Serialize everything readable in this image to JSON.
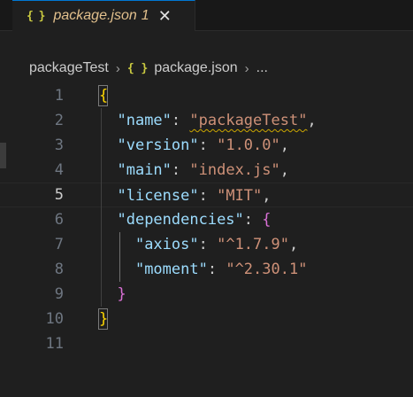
{
  "tab": {
    "icon": "{ }",
    "icon_name": "json-icon",
    "filename": "package.json",
    "problem_count": "1",
    "close_glyph": "✕",
    "accent_color": "#0078d4",
    "modified_color": "#e2c08d"
  },
  "breadcrumb": {
    "folder": "packageTest",
    "separator": "›",
    "icon": "{ }",
    "file": "package.json",
    "more": "..."
  },
  "editor": {
    "active_line": 5,
    "lines": [
      {
        "number": "1",
        "indent": "",
        "tokens": [
          {
            "t": "{",
            "c": "b1"
          }
        ]
      },
      {
        "number": "2",
        "indent": "  ",
        "tokens": [
          {
            "t": "\"name\"",
            "c": "key"
          },
          {
            "t": ": ",
            "c": "punct"
          },
          {
            "t": "\"packageTest\"",
            "c": "str",
            "squiggle": true
          },
          {
            "t": ",",
            "c": "punct"
          }
        ]
      },
      {
        "number": "3",
        "indent": "  ",
        "tokens": [
          {
            "t": "\"version\"",
            "c": "key"
          },
          {
            "t": ": ",
            "c": "punct"
          },
          {
            "t": "\"1.0.0\"",
            "c": "str"
          },
          {
            "t": ",",
            "c": "punct"
          }
        ]
      },
      {
        "number": "4",
        "indent": "  ",
        "tokens": [
          {
            "t": "\"main\"",
            "c": "key"
          },
          {
            "t": ": ",
            "c": "punct"
          },
          {
            "t": "\"index.js\"",
            "c": "str"
          },
          {
            "t": ",",
            "c": "punct"
          }
        ]
      },
      {
        "number": "5",
        "indent": "  ",
        "tokens": [
          {
            "t": "\"license\"",
            "c": "key"
          },
          {
            "t": ": ",
            "c": "punct"
          },
          {
            "t": "\"MIT\"",
            "c": "str"
          },
          {
            "t": ",",
            "c": "punct"
          }
        ]
      },
      {
        "number": "6",
        "indent": "  ",
        "tokens": [
          {
            "t": "\"dependencies\"",
            "c": "key"
          },
          {
            "t": ": ",
            "c": "punct"
          },
          {
            "t": "{",
            "c": "b2"
          }
        ]
      },
      {
        "number": "7",
        "indent": "    ",
        "tokens": [
          {
            "t": "\"axios\"",
            "c": "key"
          },
          {
            "t": ": ",
            "c": "punct"
          },
          {
            "t": "\"^1.7.9\"",
            "c": "str"
          },
          {
            "t": ",",
            "c": "punct"
          }
        ]
      },
      {
        "number": "8",
        "indent": "    ",
        "tokens": [
          {
            "t": "\"moment\"",
            "c": "key"
          },
          {
            "t": ": ",
            "c": "punct"
          },
          {
            "t": "\"^2.30.1\"",
            "c": "str"
          }
        ]
      },
      {
        "number": "9",
        "indent": "  ",
        "tokens": [
          {
            "t": "}",
            "c": "b2"
          }
        ]
      },
      {
        "number": "10",
        "indent": "",
        "tokens": [
          {
            "t": "}",
            "c": "b1"
          }
        ]
      },
      {
        "number": "11",
        "indent": "",
        "tokens": []
      }
    ]
  }
}
